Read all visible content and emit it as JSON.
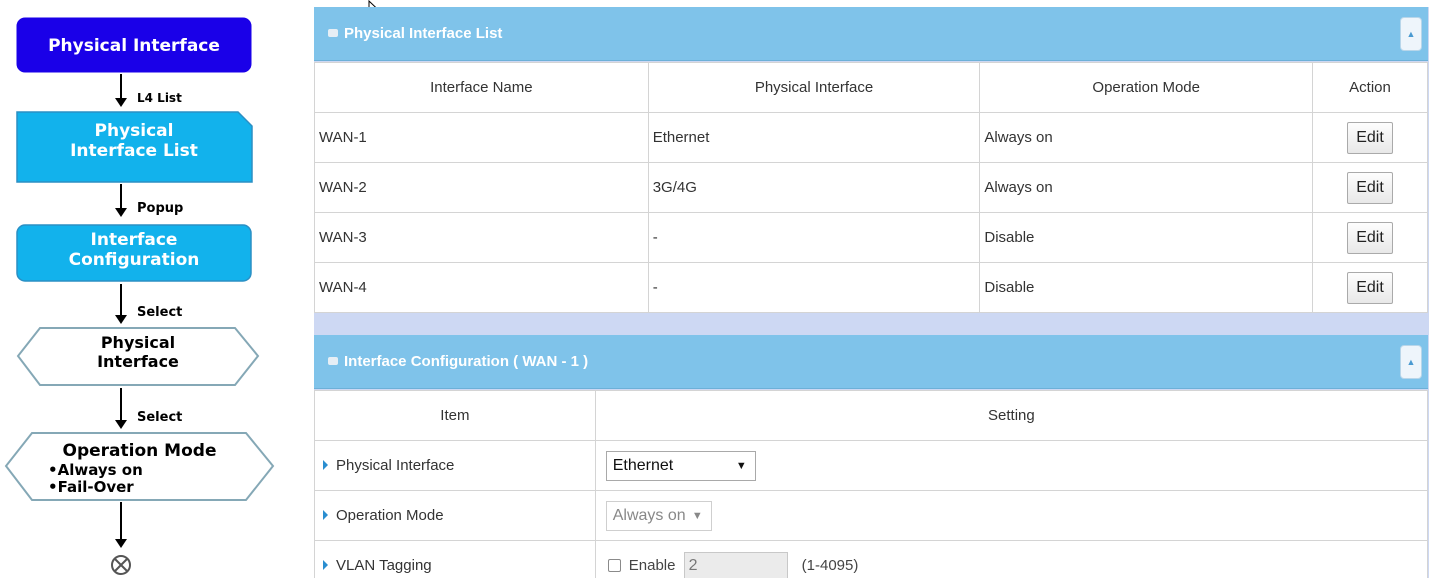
{
  "flowchart": {
    "node1": "Physical Interface",
    "label1": "L4 List",
    "node2": [
      "Physical",
      "Interface List"
    ],
    "label2": "Popup",
    "node3": [
      "Interface",
      "Configuration"
    ],
    "label3": "Select",
    "node4": [
      "Physical",
      "Interface"
    ],
    "label4": "Select",
    "node5": {
      "title": "Operation Mode",
      "bullets": [
        "•Always on",
        "•Fail-Over"
      ]
    },
    "end_symbol": "⊗"
  },
  "list_panel": {
    "title": "Physical Interface List",
    "columns": [
      "Interface Name",
      "Physical Interface",
      "Operation Mode",
      "Action"
    ],
    "rows": [
      {
        "name": "WAN-1",
        "physical": "Ethernet",
        "mode": "Always on",
        "action": "Edit"
      },
      {
        "name": "WAN-2",
        "physical": "3G/4G",
        "mode": "Always on",
        "action": "Edit"
      },
      {
        "name": "WAN-3",
        "physical": "-",
        "mode": "Disable",
        "action": "Edit"
      },
      {
        "name": "WAN-4",
        "physical": "-",
        "mode": "Disable",
        "action": "Edit"
      }
    ]
  },
  "config_panel": {
    "title": "Interface Configuration ( WAN - 1 )",
    "columns": [
      "Item",
      "Setting"
    ],
    "rows": {
      "physical_label": "Physical Interface",
      "physical_value": "Ethernet",
      "mode_label": "Operation Mode",
      "mode_value": "Always on",
      "vlan_label": "VLAN Tagging",
      "vlan_enable": "Enable",
      "vlan_value": "2",
      "vlan_range": "(1-4095)"
    }
  },
  "colors": {
    "node_dark": "#1a00e8",
    "node_light": "#12b2ec",
    "panel_header": "#7fc3ea"
  }
}
